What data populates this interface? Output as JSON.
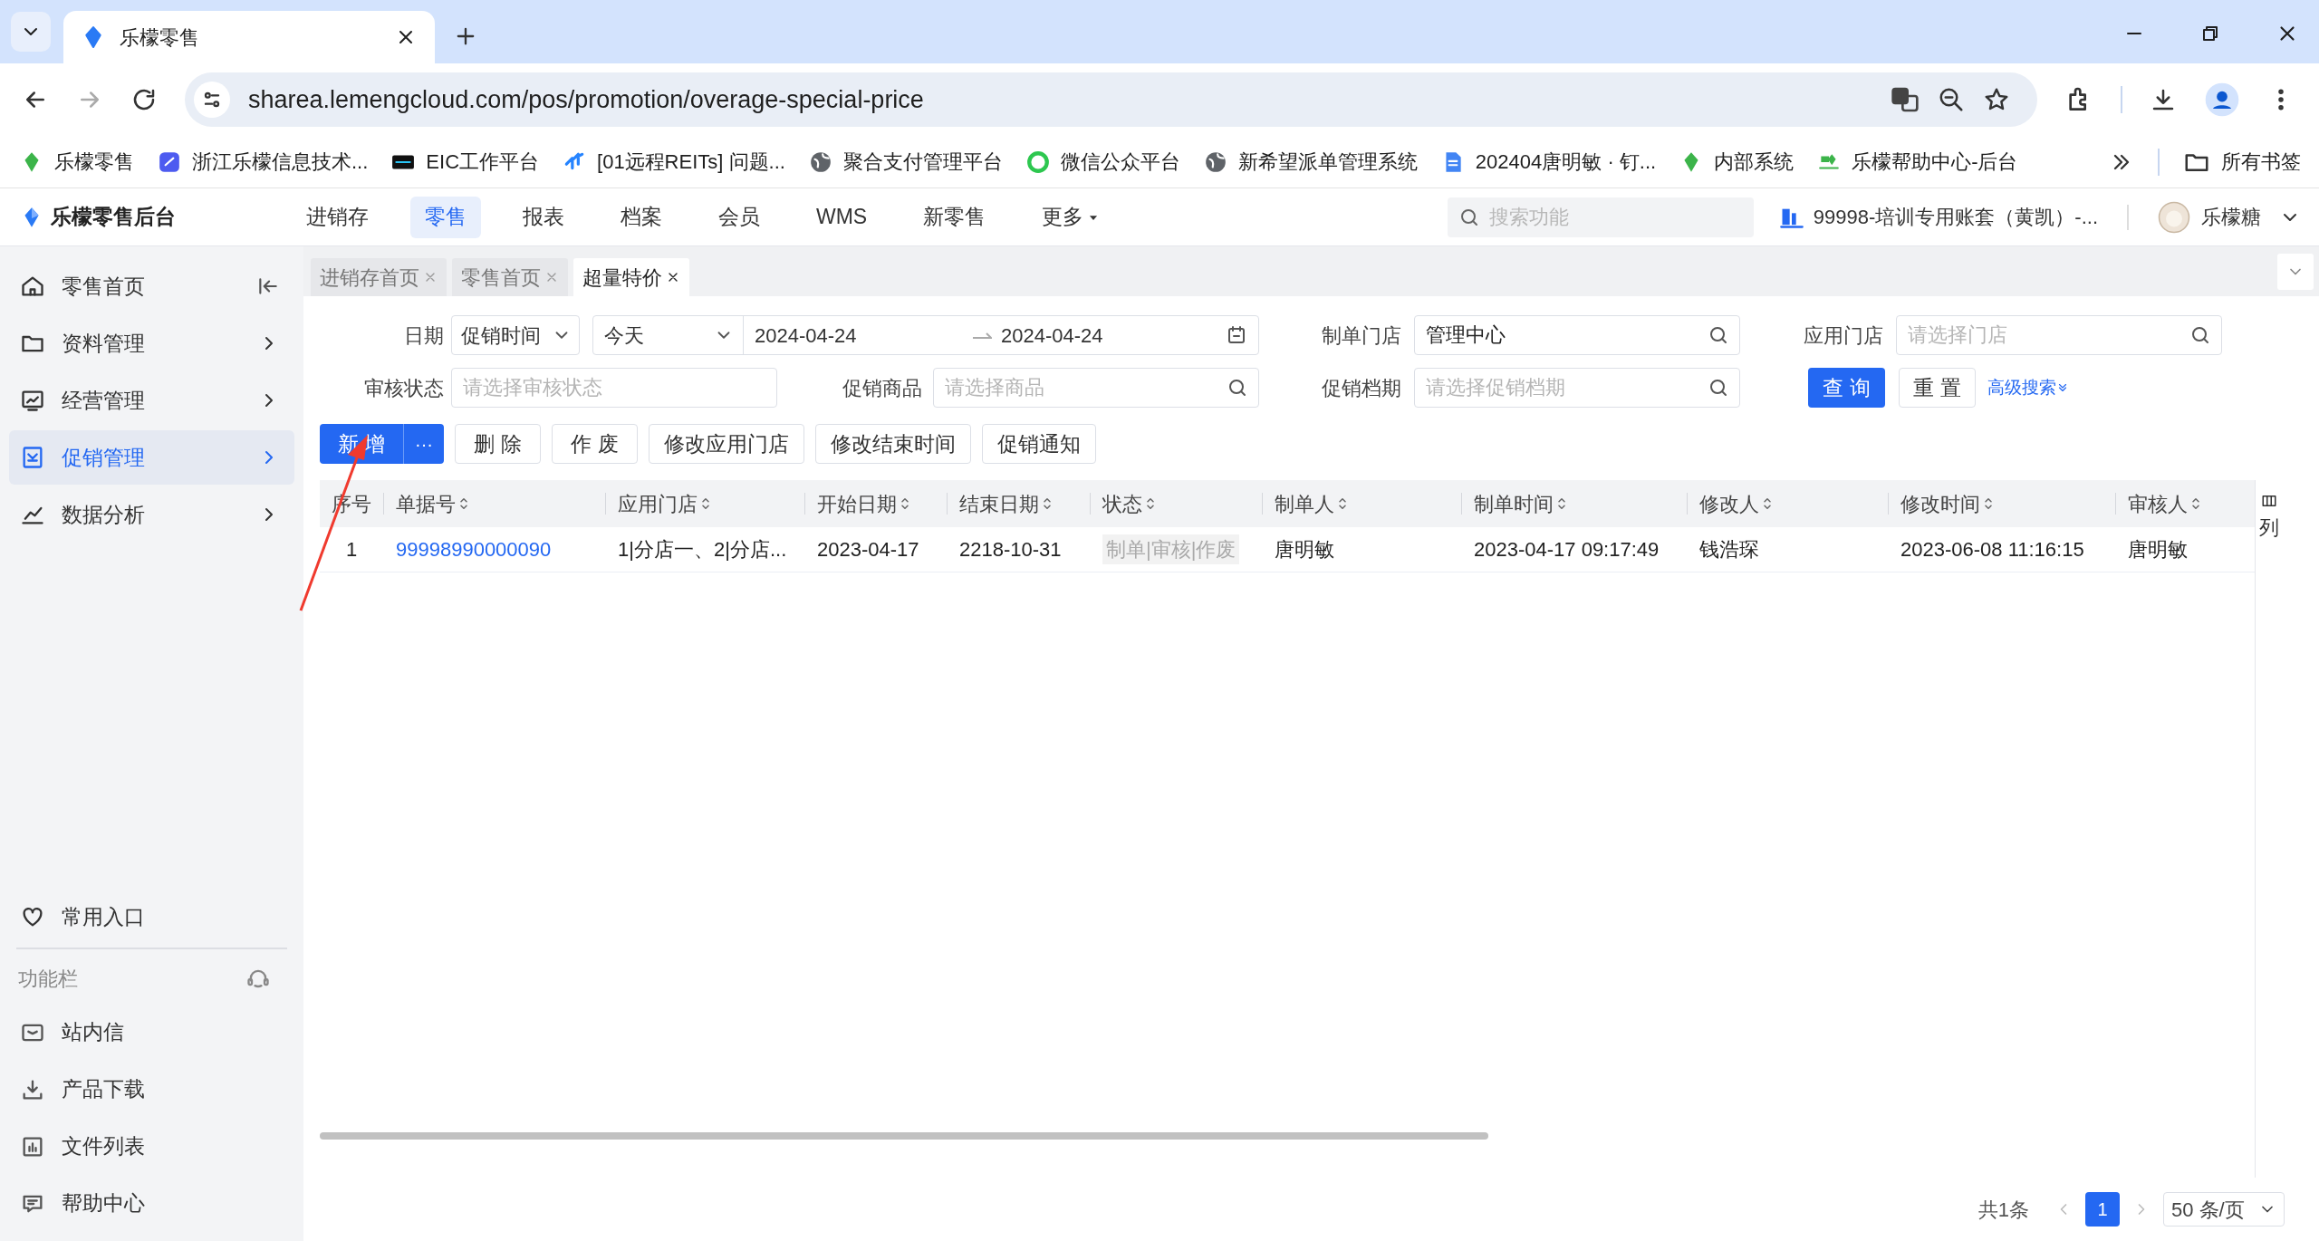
{
  "browser": {
    "tabs": [
      {
        "title": "乐檬零售",
        "selected": true
      }
    ],
    "url": "sharea.lemengcloud.com/pos/promotion/overage-special-price",
    "bookmarks": [
      "乐檬零售",
      "浙江乐檬信息技术...",
      "EIC工作平台",
      "[01远程REITs] 问题...",
      "聚合支付管理平台",
      "微信公众平台",
      "新希望派单管理系统",
      "202404唐明敏 · 钉...",
      "内部系统",
      "乐檬帮助中心-后台"
    ],
    "all_bookmarks": "所有书签"
  },
  "header": {
    "logo": "乐檬零售后台",
    "nav": [
      {
        "label": "进销存",
        "selected": false
      },
      {
        "label": "零售",
        "selected": true
      },
      {
        "label": "报表",
        "selected": false
      },
      {
        "label": "档案",
        "selected": false
      },
      {
        "label": "会员",
        "selected": false
      },
      {
        "label": "WMS",
        "selected": false
      },
      {
        "label": "新零售",
        "selected": false
      },
      {
        "label": "更多",
        "selected": false
      }
    ],
    "search": {
      "placeholder": "搜索功能"
    },
    "account": "99998-培训专用账套（黄凯）-...",
    "user": "乐檬糖"
  },
  "sidebar": {
    "items": [
      {
        "label": "零售首页",
        "selected": false
      },
      {
        "label": "资料管理",
        "selected": false
      },
      {
        "label": "经营管理",
        "selected": false
      },
      {
        "label": "促销管理",
        "selected": true
      },
      {
        "label": "数据分析",
        "selected": false
      }
    ],
    "favorites": "常用入口",
    "section": "功能栏",
    "tools": [
      "站内信",
      "产品下载",
      "文件列表",
      "帮助中心"
    ]
  },
  "page_tabs": [
    {
      "label": "进销存首页",
      "selected": false
    },
    {
      "label": "零售首页",
      "selected": false
    },
    {
      "label": "超量特价",
      "selected": true
    }
  ],
  "filters": {
    "date_label": "日期",
    "date_type": "促销时间",
    "date_preset": "今天",
    "date_from": "2024-04-24",
    "date_to": "2024-04-24",
    "maker_store_label": "制单门店",
    "maker_store_value": "管理中心",
    "apply_store_label": "应用门店",
    "apply_store_placeholder": "请选择门店",
    "audit_label": "审核状态",
    "audit_placeholder": "请选择审核状态",
    "product_label": "促销商品",
    "product_placeholder": "请选择商品",
    "period_label": "促销档期",
    "period_placeholder": "请选择促销档期",
    "query": "查 询",
    "reset": "重 置",
    "advanced": "高级搜索"
  },
  "actions": {
    "add": "新 增",
    "more": "···",
    "buttons": [
      "删 除",
      "作 废",
      "修改应用门店",
      "修改结束时间",
      "促销通知"
    ]
  },
  "table": {
    "columns": [
      {
        "label": "序号",
        "sortable": false
      },
      {
        "label": "单据号",
        "sortable": true
      },
      {
        "label": "应用门店",
        "sortable": true
      },
      {
        "label": "开始日期",
        "sortable": true
      },
      {
        "label": "结束日期",
        "sortable": true
      },
      {
        "label": "状态",
        "sortable": true
      },
      {
        "label": "制单人",
        "sortable": true
      },
      {
        "label": "制单时间",
        "sortable": true
      },
      {
        "label": "修改人",
        "sortable": true
      },
      {
        "label": "修改时间",
        "sortable": true
      },
      {
        "label": "审核人",
        "sortable": true
      }
    ],
    "rows": [
      {
        "cells": [
          "1",
          "99998990000090",
          "1|分店一、2|分店...",
          "2023-04-17",
          "2218-10-31",
          "制单|审核|作废",
          "唐明敏",
          "2023-04-17 09:17:49",
          "钱浩琛",
          "2023-06-08 11:16:15",
          "唐明敏"
        ]
      }
    ],
    "column_toggle": "列"
  },
  "pagination": {
    "total": "共1条",
    "pages": [
      {
        "label": "1",
        "selected": true
      }
    ],
    "page_size": "50 条/页"
  }
}
